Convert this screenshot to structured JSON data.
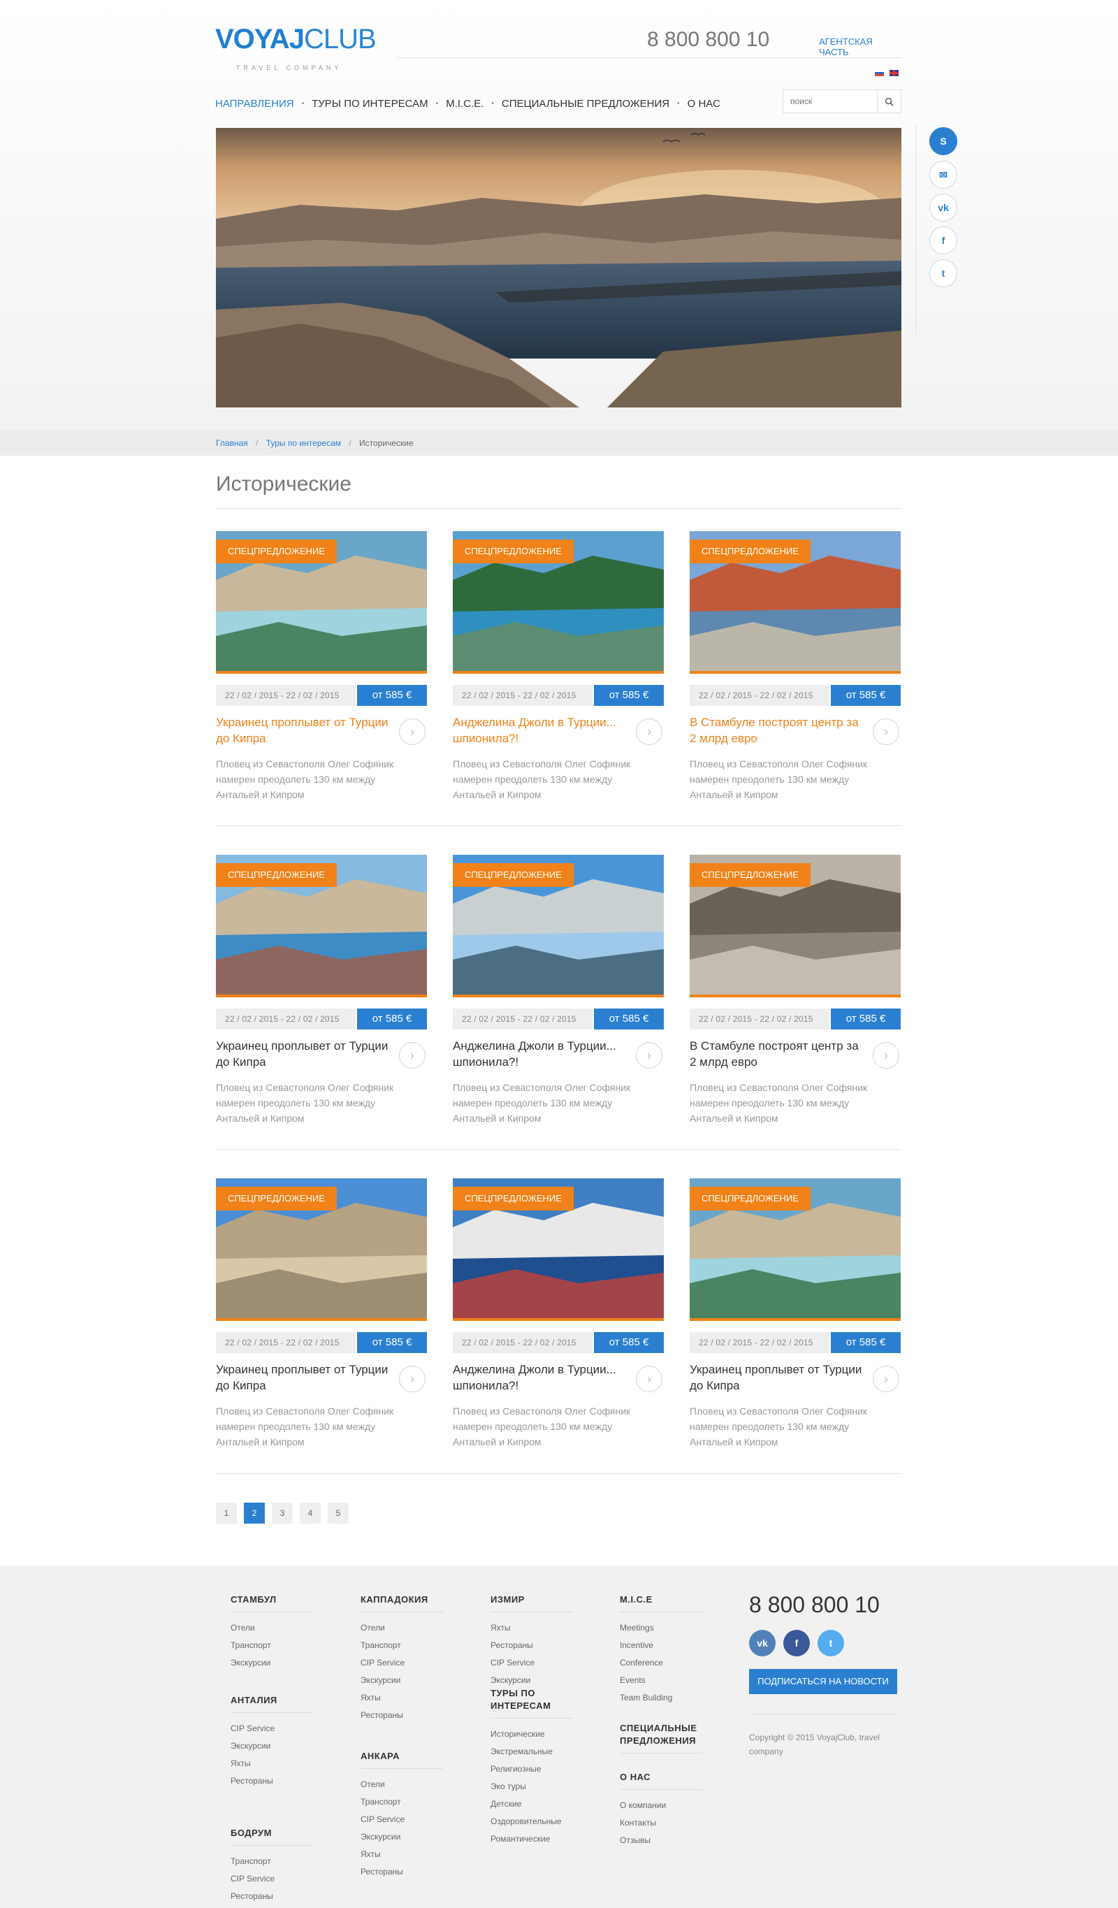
{
  "header": {
    "logo_bold": "VOYAJ",
    "logo_rest": "CLUB",
    "logo_sub": "TRAVEL COMPANY",
    "phone": "8 800 800 10",
    "agent_link": "АГЕНТСКАЯ ЧАСТЬ",
    "search_placeholder": "поиск"
  },
  "nav": {
    "items": [
      {
        "label": "НАПРАВЛЕНИЯ"
      },
      {
        "label": "ТУРЫ ПО ИНТЕРЕСАМ"
      },
      {
        "label": "M.I.C.E."
      },
      {
        "label": "СПЕЦИАЛЬНЫЕ ПРЕДЛОЖЕНИЯ"
      },
      {
        "label": "О НАС"
      }
    ],
    "separator": "•"
  },
  "social": {
    "skype": "S",
    "mail": "✉",
    "vk": "vk",
    "facebook": "f",
    "twitter": "t"
  },
  "breadcrumb": {
    "home": "Главная",
    "parent": "Туры по интересам",
    "current": "Исторические",
    "sep": "/"
  },
  "page_title": "Исторические",
  "cards": [
    {
      "badge": "СПЕЦПРЕДЛОЖЕНИЕ",
      "date": "22 / 02 / 2015 - 22 / 02 / 2015",
      "price": "от 585 €",
      "title": "Украинец проплывет от Турции до Кипра",
      "desc": "Пловец из Севастополя Олег Софяник намерен преодолеть 130 км между Антальей и Кипром"
    },
    {
      "badge": "СПЕЦПРЕДЛОЖЕНИЕ",
      "date": "22 / 02 / 2015 - 22 / 02 / 2015",
      "price": "от 585 €",
      "title": "Анджелина Джоли в Турции... шпионила?!",
      "desc": "Пловец из Севастополя Олег Софяник намерен преодолеть 130 км между Антальей и Кипром"
    },
    {
      "badge": "СПЕЦПРЕДЛОЖЕНИЕ",
      "date": "22 / 02 / 2015 - 22 / 02 / 2015",
      "price": "от 585 €",
      "title": "В Стамбуле построят центр за 2 млрд евро",
      "desc": "Пловец из Севастополя Олег Софяник намерен преодолеть 130 км между Антальей и Кипром"
    },
    {
      "badge": "СПЕЦПРЕДЛОЖЕНИЕ",
      "date": "22 / 02 / 2015 - 22 / 02 / 2015",
      "price": "от 585 €",
      "title": "Украинец проплывет от Турции до Кипра",
      "desc": "Пловец из Севастополя Олег Софяник намерен преодолеть 130 км между Антальей и Кипром"
    },
    {
      "badge": "СПЕЦПРЕДЛОЖЕНИЕ",
      "date": "22 / 02 / 2015 - 22 / 02 / 2015",
      "price": "от 585 €",
      "title": "Анджелина Джоли в Турции... шпионила?!",
      "desc": "Пловец из Севастополя Олег Софяник намерен преодолеть 130 км между Антальей и Кипром"
    },
    {
      "badge": "СПЕЦПРЕДЛОЖЕНИЕ",
      "date": "22 / 02 / 2015 - 22 / 02 / 2015",
      "price": "от 585 €",
      "title": "В Стамбуле построят центр за 2 млрд евро",
      "desc": "Пловец из Севастополя Олег Софяник намерен преодолеть 130 км между Антальей и Кипром"
    },
    {
      "badge": "СПЕЦПРЕДЛОЖЕНИЕ",
      "date": "22 / 02 / 2015 - 22 / 02 / 2015",
      "price": "от 585 €",
      "title": "Украинец проплывет от Турции до Кипра",
      "desc": "Пловец из Севастополя Олег Софяник намерен преодолеть 130 км между Антальей и Кипром"
    },
    {
      "badge": "СПЕЦПРЕДЛОЖЕНИЕ",
      "date": "22 / 02 / 2015 - 22 / 02 / 2015",
      "price": "от 585 €",
      "title": "Анджелина Джоли в Турции... шпионила?!",
      "desc": "Пловец из Севастополя Олег Софяник намерен преодолеть 130 км между Антальей и Кипром"
    },
    {
      "badge": "СПЕЦПРЕДЛОЖЕНИЕ",
      "date": "22 / 02 / 2015 - 22 / 02 / 2015",
      "price": "от 585 €",
      "title": "Украинец проплывет от Турции до Кипра",
      "desc": "Пловец из Севастополя Олег Софяник намерен преодолеть 130 км между Антальей и Кипром"
    }
  ],
  "pagination": [
    "1",
    "2",
    "3",
    "4",
    "5"
  ],
  "pagination_current": "2",
  "footer": {
    "col1": {
      "groups": [
        {
          "title": "СТАМБУЛ",
          "links": [
            "Отели",
            "Транспорт",
            "Экскурсии"
          ]
        },
        {
          "title": "АНТАЛИЯ",
          "links": [
            "CIP Service",
            "Экскурсии",
            "Яхты",
            "Рестораны"
          ]
        },
        {
          "title": "БОДРУМ",
          "links": [
            "Транспорт",
            "CIP Service",
            "Рестораны"
          ]
        }
      ]
    },
    "col2": {
      "groups": [
        {
          "title": "КАППАДОКИЯ",
          "links": [
            "Отели",
            "Транспорт",
            "CIP Service",
            "Экскурсии",
            "Яхты",
            "Рестораны"
          ]
        },
        {
          "title": "АНКАРА",
          "links": [
            "Отели",
            "Транспорт",
            "CIP Service",
            "Экскурсии",
            "Яхты",
            "Рестораны"
          ]
        }
      ]
    },
    "col3": {
      "groups": [
        {
          "title": "ИЗМИР",
          "links": [
            "Яхты",
            "Рестораны",
            "CIP Service",
            "Экскурсии"
          ]
        },
        {
          "title": "ТУРЫ ПО ИНТЕРЕСАМ",
          "links": [
            "Исторические",
            "Экстремальные",
            "Религиозные",
            "Эко туры",
            "Детские",
            "Оздоровительные",
            "Романтические"
          ]
        }
      ]
    },
    "col4": {
      "groups": [
        {
          "title": "M.I.C.E",
          "links": [
            "Meetings",
            "Incentive",
            "Conference",
            "Events",
            "Team Building"
          ]
        },
        {
          "title": "СПЕЦИАЛЬНЫЕ ПРЕДЛОЖЕНИЯ",
          "links": []
        },
        {
          "title": "О НАС",
          "links": [
            "О компании",
            "Контакты",
            "Отзывы"
          ]
        }
      ]
    },
    "phone": "8 800 800 10",
    "subscribe": "ПОДПИСАТЬСЯ НА НОВОСТИ",
    "copyright": "Copyright © 2015 VoyajClub, travel company",
    "social": {
      "vk": "vk",
      "facebook": "f",
      "twitter": "t"
    }
  },
  "colors": {
    "accent_blue": "#2a7fd0",
    "accent_orange": "#f08219",
    "vk": "#5181b8",
    "facebook": "#3b5998",
    "twitter": "#55acee"
  }
}
